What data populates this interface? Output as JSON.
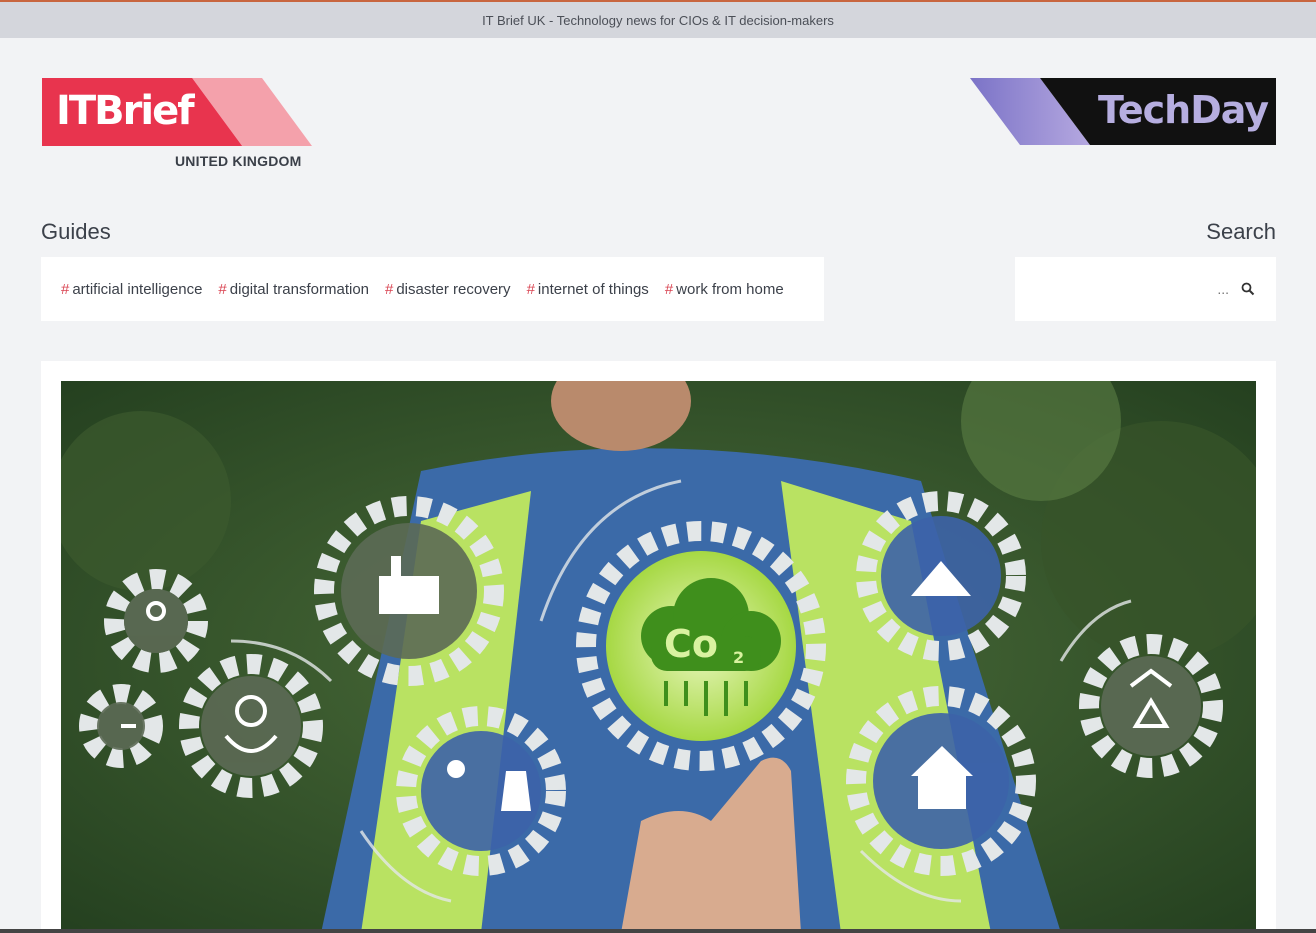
{
  "window": {
    "title": "IT Brief UK - Technology news for CIOs & IT decision-makers"
  },
  "header": {
    "logo_main": {
      "text_it": "IT",
      "text_brief": "Brief",
      "region": "UNITED KINGDOM"
    },
    "logo_partner": {
      "text": "TechDay"
    }
  },
  "guides": {
    "title": "Guides",
    "tags": [
      {
        "hash": "#",
        "label": "artificial intelligence"
      },
      {
        "hash": "#",
        "label": "digital transformation"
      },
      {
        "hash": "#",
        "label": "disaster recovery"
      },
      {
        "hash": "#",
        "label": "internet of things"
      },
      {
        "hash": "#",
        "label": "work from home"
      }
    ]
  },
  "search": {
    "title": "Search",
    "placeholder": "..."
  },
  "hero": {
    "image": "sustainability-gears-co2-illustration"
  },
  "colors": {
    "brand_red": "#e8344e",
    "brand_pink": "#f4a1ab",
    "techday_dark": "#111111",
    "techday_purple": "#9a8fd1",
    "tag_hash": "#d94452"
  },
  "co2_label": "Co",
  "co2_sub": "2"
}
